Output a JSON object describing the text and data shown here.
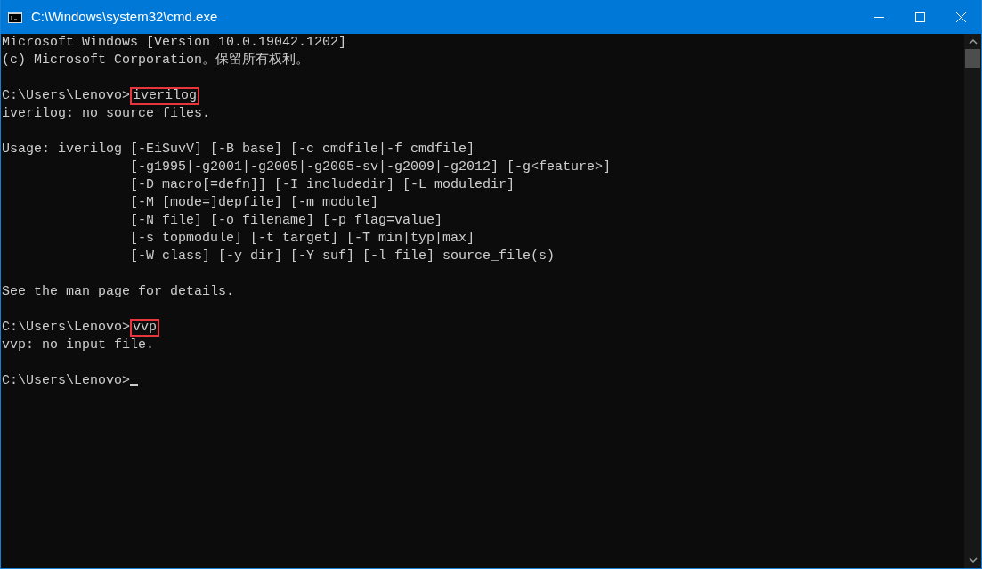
{
  "window": {
    "title": "C:\\Windows\\system32\\cmd.exe"
  },
  "console": {
    "lines": [
      {
        "kind": "text",
        "text": "Microsoft Windows [Version 10.0.19042.1202]"
      },
      {
        "kind": "text",
        "text": "(c) Microsoft Corporation。保留所有权利。"
      },
      {
        "kind": "blank"
      },
      {
        "kind": "prompt",
        "prompt": "C:\\Users\\Lenovo>",
        "command": "iverilog",
        "highlighted": true
      },
      {
        "kind": "text",
        "text": "iverilog: no source files."
      },
      {
        "kind": "blank"
      },
      {
        "kind": "text",
        "text": "Usage: iverilog [-EiSuvV] [-B base] [-c cmdfile|-f cmdfile]"
      },
      {
        "kind": "text",
        "text": "                [-g1995|-g2001|-g2005|-g2005-sv|-g2009|-g2012] [-g<feature>]"
      },
      {
        "kind": "text",
        "text": "                [-D macro[=defn]] [-I includedir] [-L moduledir]"
      },
      {
        "kind": "text",
        "text": "                [-M [mode=]depfile] [-m module]"
      },
      {
        "kind": "text",
        "text": "                [-N file] [-o filename] [-p flag=value]"
      },
      {
        "kind": "text",
        "text": "                [-s topmodule] [-t target] [-T min|typ|max]"
      },
      {
        "kind": "text",
        "text": "                [-W class] [-y dir] [-Y suf] [-l file] source_file(s)"
      },
      {
        "kind": "blank"
      },
      {
        "kind": "text",
        "text": "See the man page for details."
      },
      {
        "kind": "blank"
      },
      {
        "kind": "prompt",
        "prompt": "C:\\Users\\Lenovo>",
        "command": "vvp",
        "highlighted": true
      },
      {
        "kind": "text",
        "text": "vvp: no input file."
      },
      {
        "kind": "blank"
      },
      {
        "kind": "prompt",
        "prompt": "C:\\Users\\Lenovo>",
        "cursor": true
      }
    ]
  }
}
